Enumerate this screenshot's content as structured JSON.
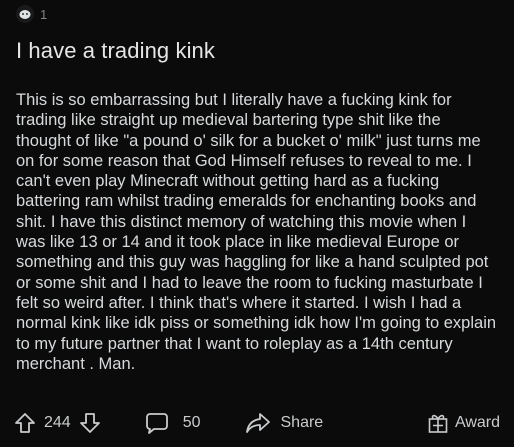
{
  "header": {
    "award_count": "1"
  },
  "post": {
    "title": "I have a trading kink",
    "body": "This is so embarrassing but I literally have a fucking kink for trading like straight up medieval bartering type shit like the thought of like \"a pound o' silk for a bucket o' milk\" just turns me on for some reason that God Himself refuses to reveal to me. I can't even play Minecraft without getting hard as a fucking battering ram whilst trading emeralds for enchanting books and shit. I have this distinct memory of watching this movie when I was like 13 or 14 and it took place in like medieval Europe or something and this guy was haggling for like a hand sculpted pot or some shit and I had to leave the room to fucking masturbate I felt so weird after. I think that's where it started. I wish I had a normal kink like idk piss or something idk how I'm going to explain to my future partner that I want to roleplay as a 14th century merchant . Man."
  },
  "actions": {
    "score": "244",
    "comments": "50",
    "share_label": "Share",
    "award_label": "Award"
  }
}
